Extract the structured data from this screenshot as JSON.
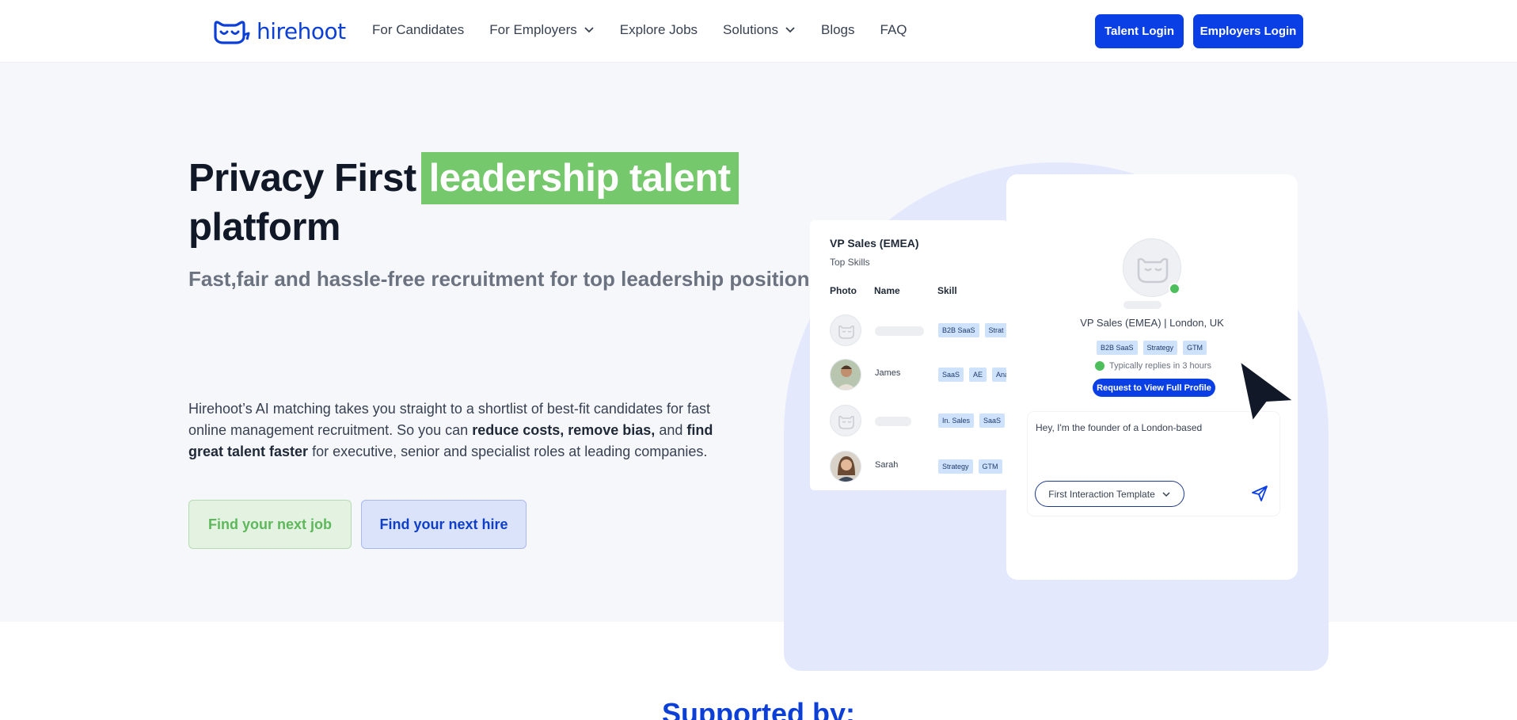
{
  "brand": {
    "name": "hirehoot",
    "accent": "#0b3fe6",
    "highlight": "#75c96c"
  },
  "nav": {
    "items": [
      {
        "label": "For Candidates",
        "dropdown": false
      },
      {
        "label": "For Employers",
        "dropdown": true
      },
      {
        "label": "Explore Jobs",
        "dropdown": false
      },
      {
        "label": "Solutions",
        "dropdown": true
      },
      {
        "label": "Blogs",
        "dropdown": false
      },
      {
        "label": "FAQ",
        "dropdown": false
      }
    ],
    "talent_login": "Talent Login",
    "employers_login": "Employers Login"
  },
  "hero": {
    "headline_prefix": "Privacy First",
    "headline_accent": "leadership talent",
    "headline_suffix": "platform",
    "subheading": "Fast,fair and hassle-free recruitment for top leadership positions",
    "para_1": "Hirehoot’s AI matching takes you straight to a shortlist of best-fit candidates for fast online management recruitment. So you can ",
    "para_bold_1": "reduce costs, remove bias,",
    "para_2": " and ",
    "para_bold_2": "find great talent faster",
    "para_3": " for executive, senior and specialist roles at leading companies.",
    "cta_job": "Find your next job",
    "cta_hire": "Find your next hire"
  },
  "shortlist": {
    "title": "VP Sales (EMEA)",
    "subtitle": "Top Skills",
    "col_photo": "Photo",
    "col_name": "Name",
    "col_skill": "Skill",
    "rows": [
      {
        "name": "",
        "tags": [
          "B2B SaaS",
          "Strat"
        ]
      },
      {
        "name": "James",
        "tags": [
          "SaaS",
          "AE",
          "Ana"
        ]
      },
      {
        "name": "",
        "tags": [
          "In. Sales",
          "SaaS"
        ]
      },
      {
        "name": "Sarah",
        "tags": [
          "Strategy",
          "GTM"
        ]
      }
    ]
  },
  "profile": {
    "role": "VP Sales (EMEA) | London, UK",
    "tags": [
      "B2B SaaS",
      "Strategy",
      "GTM"
    ],
    "reply_status": "Typically replies in 3 hours",
    "request_btn": "Request to View Full Profile",
    "message": "Hey, I'm the founder of a London-based",
    "template_btn": "First Interaction Template"
  },
  "supported_by": "Supported by:"
}
